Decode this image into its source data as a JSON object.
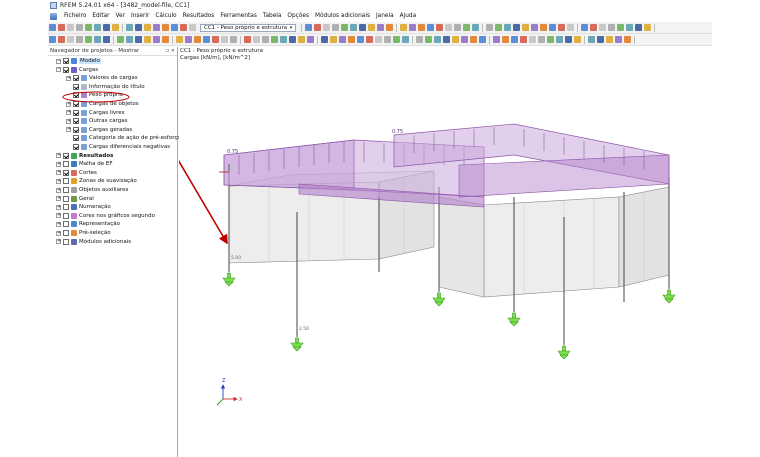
{
  "window": {
    "title": "RFEM 5.24.01 x64 - [3482_model-file, CC1]"
  },
  "menu": [
    "Ficheiro",
    "Editar",
    "Ver",
    "Inserir",
    "Cálculo",
    "Resultados",
    "Ferramentas",
    "Tabela",
    "Opções",
    "Módulos adicionais",
    "Janela",
    "Ajuda"
  ],
  "toolbar": {
    "load_case": "CC1 - Peso próprio e estrutura"
  },
  "navigator": {
    "title": "Navegador de projetos - Mostrar",
    "items": [
      {
        "label": "Modelo"
      },
      {
        "label": "Cargas"
      },
      {
        "label": "Valores de cargas"
      },
      {
        "label": "Informação do título"
      },
      {
        "label": "Peso próprio"
      },
      {
        "label": "Cargas de objetos"
      },
      {
        "label": "Cargas livres"
      },
      {
        "label": "Outras cargas"
      },
      {
        "label": "Cargas geradas"
      },
      {
        "label": "Categoria de ação de pré-esforço"
      },
      {
        "label": "Cargas diferenciais negativas"
      },
      {
        "label": "Resultados"
      },
      {
        "label": "Malha de EF"
      },
      {
        "label": "Cortes"
      },
      {
        "label": "Zonas de suavização"
      },
      {
        "label": "Objetos auxiliares"
      },
      {
        "label": "Geral"
      },
      {
        "label": "Numeração"
      },
      {
        "label": "Cores nos gráficos segundo"
      },
      {
        "label": "Representação"
      },
      {
        "label": "Pré-seleção"
      },
      {
        "label": "Módulos adicionais"
      }
    ]
  },
  "view": {
    "header_line1": "CC1 : Peso próprio e estrutura",
    "header_line2": "Cargas [kN/m], [kN/m^2]",
    "load_value_left": "0.75",
    "load_value_right": "0.75",
    "support_label": "5.00",
    "column_label": "2.50",
    "axis_z": "Z",
    "axis_x": "X"
  },
  "colors": {
    "load_fill": "#c9a6d9",
    "load_edge": "#8a55a8",
    "support": "#7ae04a",
    "annotation_arrow": "#c00000",
    "selection_bg": "#cce4ff"
  }
}
